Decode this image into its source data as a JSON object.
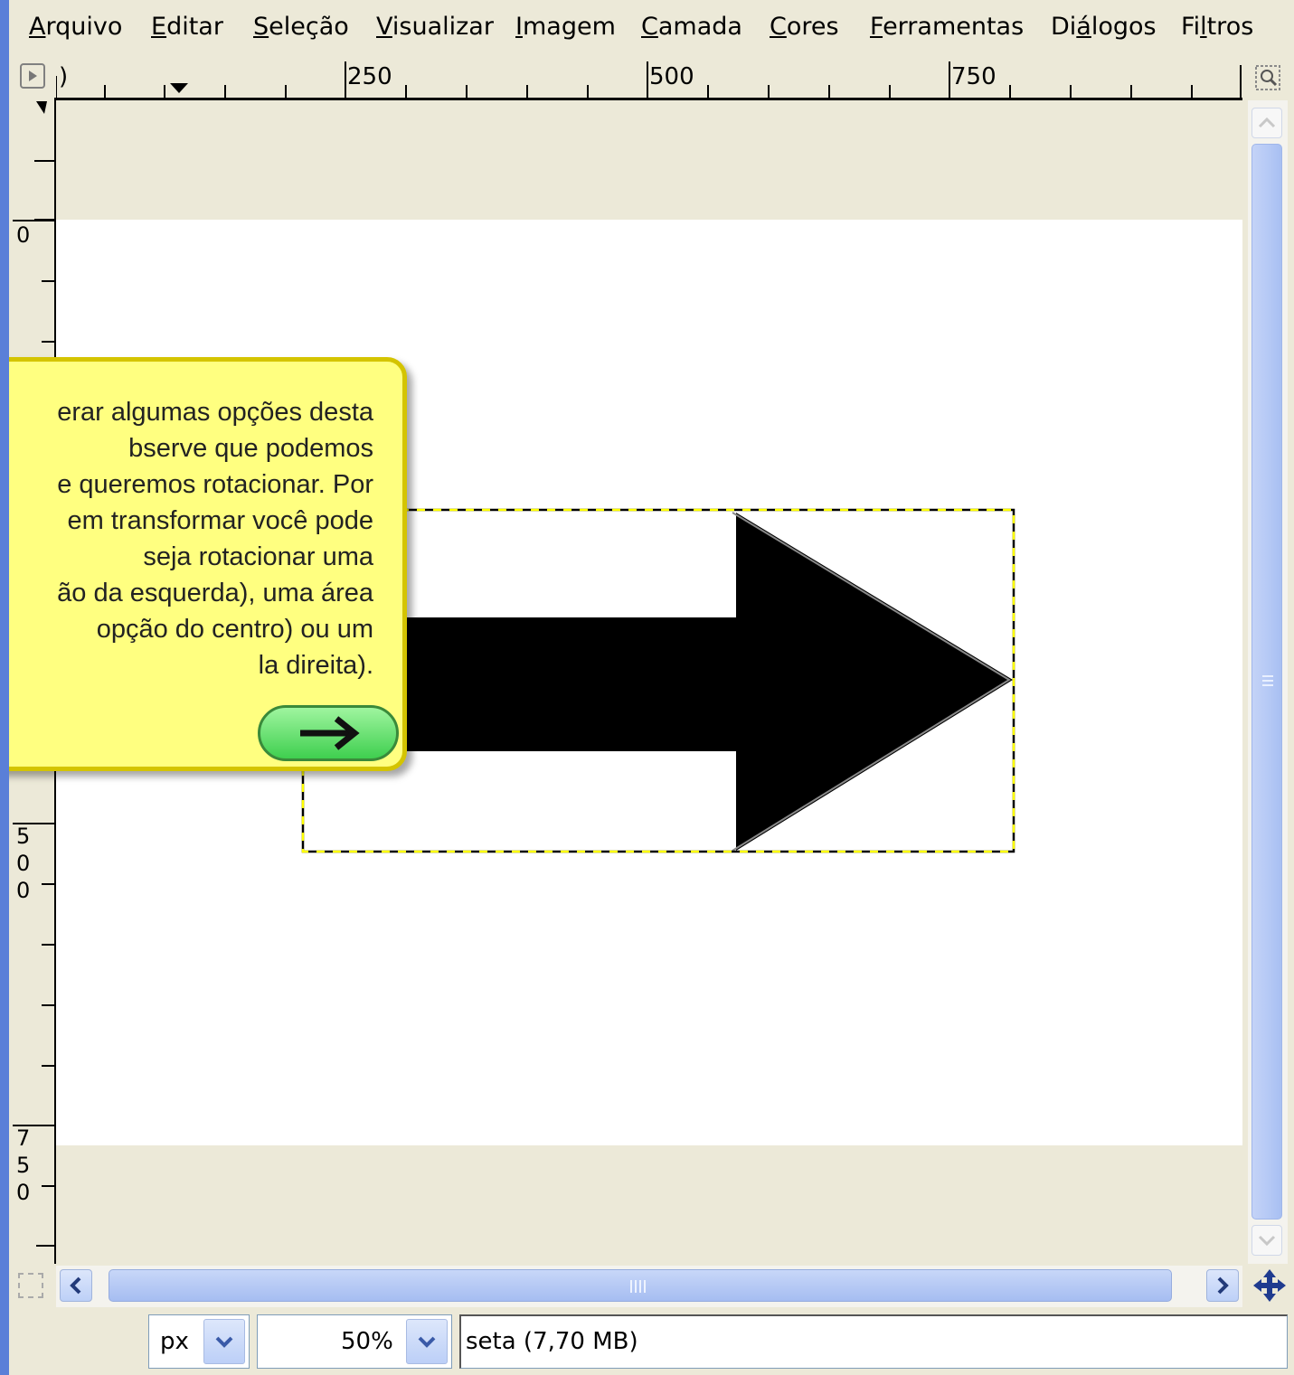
{
  "menubar": {
    "items": [
      {
        "label": "Arquivo",
        "mnemonic_index": 0
      },
      {
        "label": "Editar",
        "mnemonic_index": 0
      },
      {
        "label": "Seleção",
        "mnemonic_index": 0
      },
      {
        "label": "Visualizar",
        "mnemonic_index": 0
      },
      {
        "label": "Imagem",
        "mnemonic_index": 0
      },
      {
        "label": "Camada",
        "mnemonic_index": 0
      },
      {
        "label": "Cores",
        "mnemonic_index": 0
      },
      {
        "label": "Ferramentas",
        "mnemonic_index": 0
      },
      {
        "label": "Diálogos",
        "mnemonic_index": 2
      },
      {
        "label": "Filtros",
        "mnemonic_index": 2
      }
    ]
  },
  "rulers": {
    "horizontal_labels": [
      ")",
      "250",
      "500",
      "750"
    ],
    "vertical_labels": [
      "0",
      "500",
      "750"
    ]
  },
  "tooltip": {
    "lines": [
      "erar algumas opções desta",
      "bserve que podemos",
      "e queremos rotacionar. Por",
      "em transformar você pode",
      "seja rotacionar uma",
      "ão da esquerda), uma área",
      "opção do centro) ou um",
      "la direita)."
    ],
    "next_icon": "right-arrow-icon"
  },
  "statusbar": {
    "unit": "px",
    "zoom": "50%",
    "image_info": "seta (7,70 MB)"
  },
  "colors": {
    "tooltip_bg": "#ffff80",
    "tooltip_border": "#d4c400",
    "selection_marching_ants": "#ffff00",
    "canvas_bg": "#ece9d8",
    "scroll_thumb": "#b4c8f5"
  }
}
